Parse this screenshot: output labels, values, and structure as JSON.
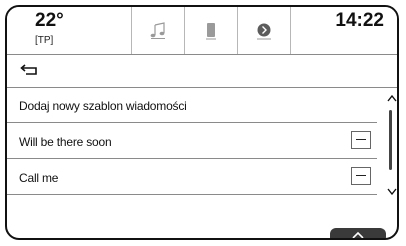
{
  "status": {
    "temperature": "22°",
    "traffic_program": "[TP]",
    "time": "14:22"
  },
  "tabs": [
    {
      "icon": "music-note-icon"
    },
    {
      "icon": "phone-icon"
    },
    {
      "icon": "navigation-icon"
    }
  ],
  "back": {
    "icon": "back-arrow-icon"
  },
  "list": {
    "items": [
      {
        "label": "Dodaj nowy szablon wiadomości"
      },
      {
        "label": "Will be there soon"
      },
      {
        "label": "Call me"
      }
    ]
  },
  "colors": {
    "text": "#111111",
    "divider": "#8a8a8a",
    "up_button": "#3a3a3a"
  }
}
